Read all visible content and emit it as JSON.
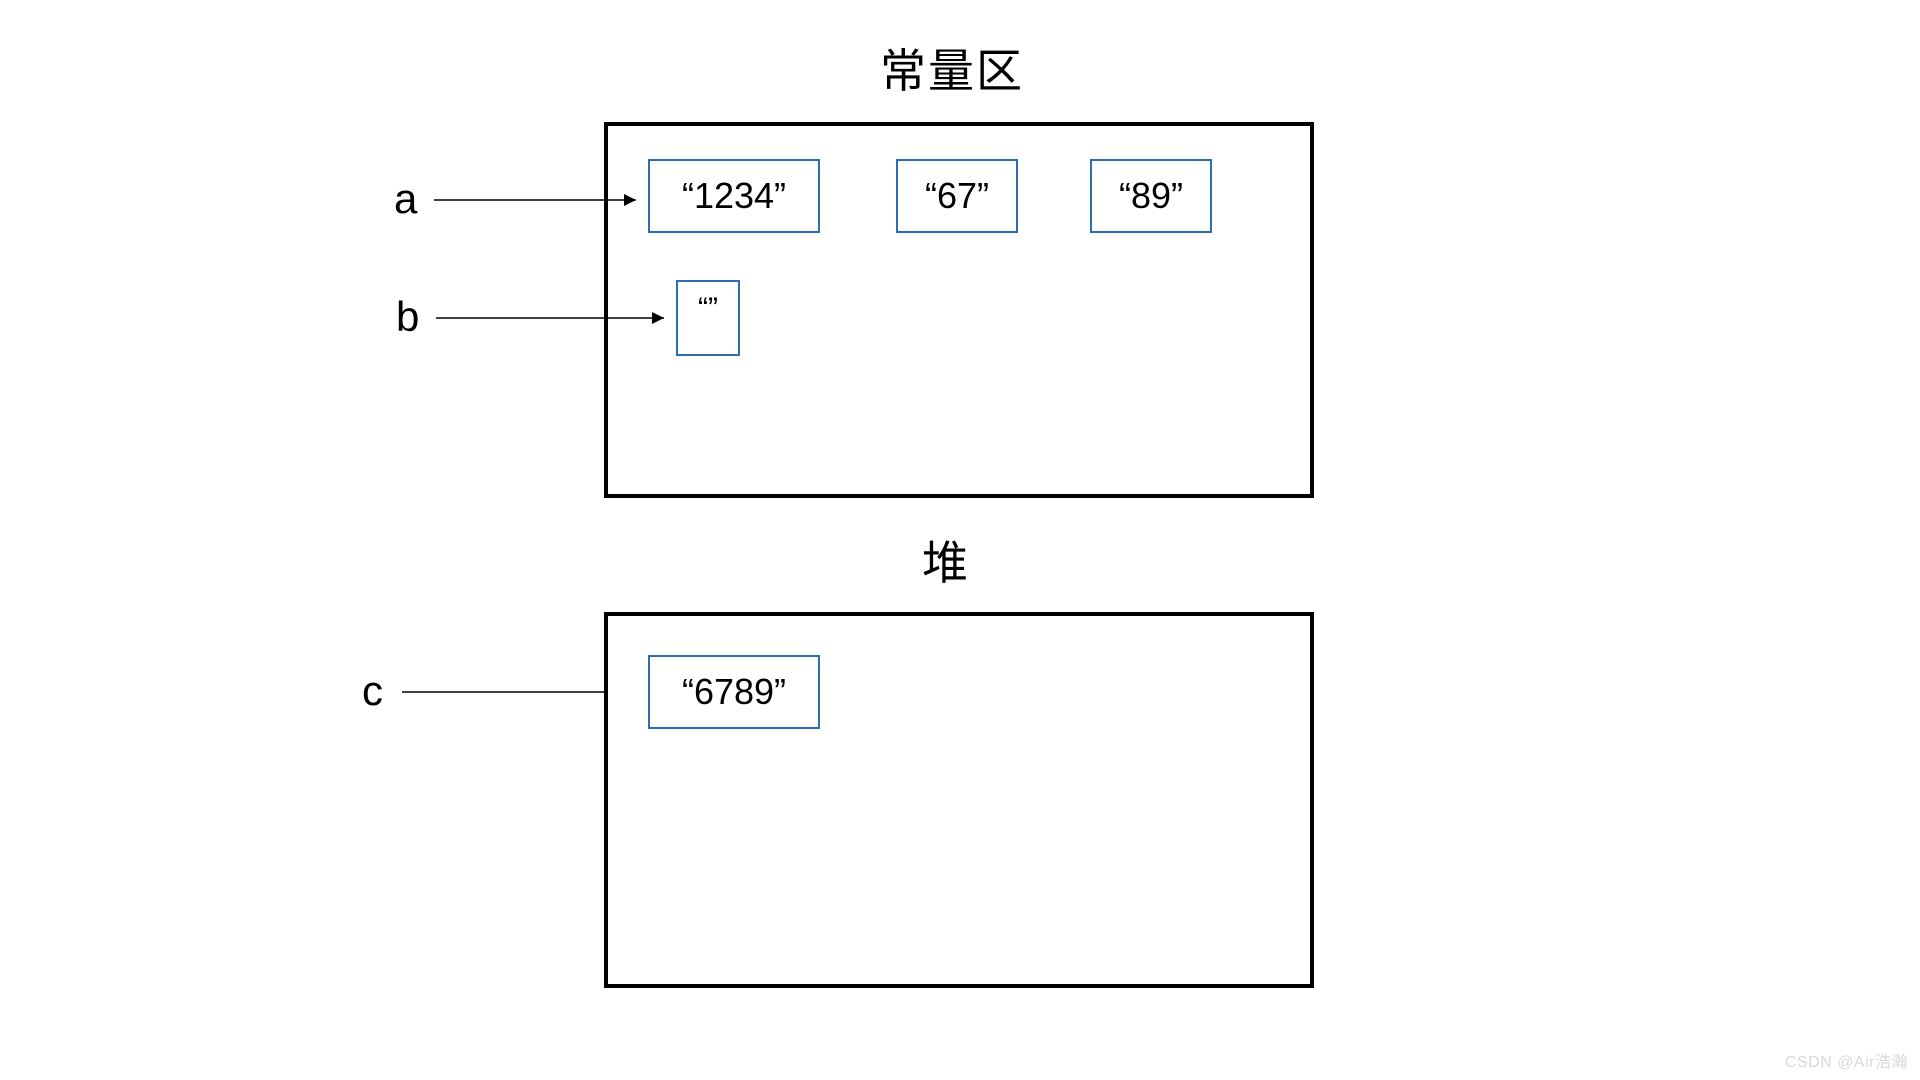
{
  "titles": {
    "constant_area": "常量区",
    "heap": "堆"
  },
  "labels": {
    "a": "a",
    "b": "b",
    "c": "c"
  },
  "values": {
    "v1234": "“1234”",
    "v67": "“67”",
    "v89": "“89”",
    "empty": "“”",
    "v6789": "“6789”"
  },
  "watermark": "CSDN @Air浩瀚"
}
